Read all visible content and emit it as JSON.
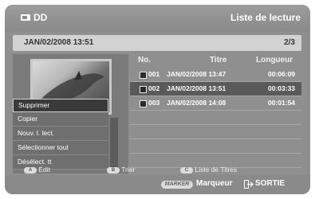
{
  "header": {
    "app_title": "DD",
    "screen_title": "Liste de lecture",
    "disc_icon": "disc-icon"
  },
  "infobar": {
    "current_date": "JAN/02/2008 13:51",
    "page_indicator": "2/3"
  },
  "table": {
    "columns": [
      "No.",
      "Titre",
      "Longueur"
    ],
    "rows": [
      {
        "no": "001",
        "title": "JAN/02/2008 13:47",
        "length": "00:06:09",
        "selected": false
      },
      {
        "no": "002",
        "title": "JAN/02/2008 13:51",
        "length": "00:03:33",
        "selected": true
      },
      {
        "no": "003",
        "title": "JAN/02/2008 14:08",
        "length": "00:01:54",
        "selected": false
      }
    ]
  },
  "context_menu": {
    "items": [
      "Supprimer",
      "Copier",
      "Nouv. l. lect.",
      "Sélectionner tout",
      "Désélect. tt"
    ],
    "selected_index": 0
  },
  "button_hints": {
    "a": {
      "key": "A",
      "label": "Édit"
    },
    "b": {
      "key": "B",
      "label": "Trier"
    },
    "c": {
      "key": "C",
      "label": "Liste de Titres"
    }
  },
  "bottom": {
    "marker_key": "MARKER",
    "marker_label": "Marqueur",
    "exit_icon": "exit-icon",
    "exit_label": "SORTIE"
  }
}
